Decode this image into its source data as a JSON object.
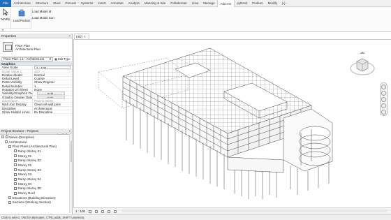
{
  "ribbon": {
    "file_label": "File",
    "tabs": [
      "Architecture",
      "Structure",
      "Steel",
      "Precast",
      "Systems",
      "Insert",
      "Annotate",
      "Analyze",
      "Massing & Site",
      "Collaborate",
      "View",
      "Manage",
      "Add-Ins",
      "pyRevit",
      "Podium",
      "Modify",
      "(•) -"
    ],
    "active_tab": "Add-Ins",
    "modify_label": "Modify",
    "load_podium_label": "Load Podium",
    "load_model_id_label": "Load Model Id",
    "load_model_icon_label": "Load Model Icon"
  },
  "properties": {
    "title": "Properties",
    "type_name": "Floor Plan",
    "type_sub": "Architectural Plan",
    "instance": "Floor Plan: L1 - Architectural",
    "edit_type": "Edit Type",
    "section": "Graphics",
    "rows": [
      {
        "k": "View Scale",
        "v": "1 : 100"
      },
      {
        "k": "Scale Value    1:",
        "v": "100"
      },
      {
        "k": "Display Model",
        "v": "Normal"
      },
      {
        "k": "Detail Level",
        "v": "Coarse"
      },
      {
        "k": "Parts Visibility",
        "v": "Show Original"
      },
      {
        "k": "Detail Number",
        "v": "1"
      },
      {
        "k": "Rotation on Sheet",
        "v": "None"
      },
      {
        "k": "Visibility/Graphics Over...",
        "v": "Edit..."
      },
      {
        "k": "Graphic Display Options",
        "v": "Edit..."
      },
      {
        "k": "Orientation",
        "v": "Project North"
      },
      {
        "k": "Wall Join Display",
        "v": "Clean all wall joins"
      },
      {
        "k": "Discipline",
        "v": "Architectural"
      },
      {
        "k": "Show Hidden Lines",
        "v": "By Discipline"
      }
    ],
    "help": "Properties help",
    "apply": "Apply"
  },
  "browser": {
    "title": "Project Browser - Project1",
    "items": [
      {
        "label": "Views (Discipline)",
        "level": 0
      },
      {
        "label": "Architectural",
        "level": 1
      },
      {
        "label": "Floor Plans (Architectural Plan)",
        "level": 2
      },
      {
        "label": "Ramp Storey 01",
        "level": 3
      },
      {
        "label": "Storey 01",
        "level": 3
      },
      {
        "label": "Ramp Storey 02",
        "level": 3
      },
      {
        "label": "Storey 02",
        "level": 3
      },
      {
        "label": "Ramp Storey 03",
        "level": 3
      },
      {
        "label": "Storey 03",
        "level": 3
      },
      {
        "label": "Ramp Storey 04",
        "level": 3
      },
      {
        "label": "Storey 04",
        "level": 3
      },
      {
        "label": "Ramp Storey 05",
        "level": 3
      },
      {
        "label": "Storey Roof",
        "level": 3
      },
      {
        "label": "Elevations (Building Elevation)",
        "level": 2
      },
      {
        "label": "Sections (Working Section)",
        "level": 2
      }
    ]
  },
  "view": {
    "tab_label": "{3D}",
    "scale": "1 : 100"
  },
  "status": "Click to select, TAB for alternates, CTRL adds, SHIFT unselects."
}
